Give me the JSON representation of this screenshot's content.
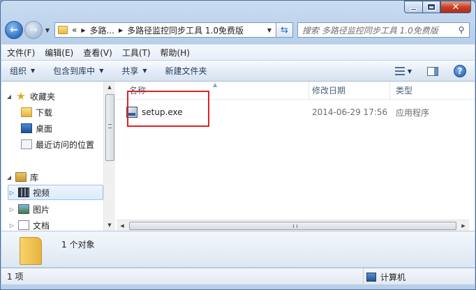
{
  "window": {
    "caption": {
      "minimize": "minimize-icon",
      "maximize": "maximize-icon",
      "close": "close-icon"
    }
  },
  "address_bar": {
    "overflow": "«",
    "crumbs": [
      "多路...",
      "多路径监控同步工具 1.0免费版"
    ]
  },
  "search": {
    "placeholder": "搜索 多路径监控同步工具 1.0免费版"
  },
  "menu": [
    "文件(F)",
    "编辑(E)",
    "查看(V)",
    "工具(T)",
    "帮助(H)"
  ],
  "commands": {
    "organize": "组织",
    "include_library": "包含到库中",
    "share": "共享",
    "new_folder": "新建文件夹"
  },
  "nav_pane": {
    "favorites": "收藏夹",
    "favorites_items": [
      "下载",
      "桌面",
      "最近访问的位置"
    ],
    "libraries": "库",
    "library_items": [
      "视频",
      "图片",
      "文档"
    ],
    "selected_item": "视频"
  },
  "columns": {
    "name": "名称",
    "date": "修改日期",
    "type": "类型"
  },
  "files": [
    {
      "name": "setup.exe",
      "date": "2014-06-29 17:56",
      "type": "应用程序",
      "icon": "setup-exe-icon"
    }
  ],
  "details": {
    "count_text": "1 个对象"
  },
  "status": {
    "items": "1 项",
    "zone": "计算机"
  },
  "colors": {
    "highlight_border": "#e0202a",
    "accent": "#2f6fc2"
  }
}
